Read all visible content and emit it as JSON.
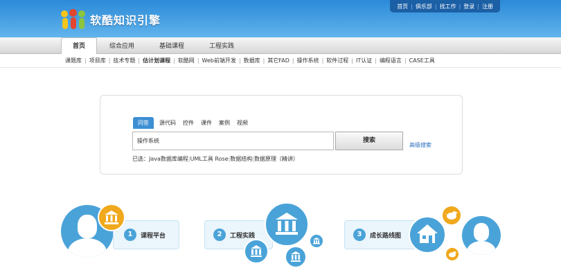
{
  "header": {
    "logo_text": "软酷知识引擎",
    "top_links": [
      "首页",
      "俱乐部",
      "找工作",
      "登录",
      "注册"
    ]
  },
  "nav": {
    "tabs": [
      "首页",
      "综合应用",
      "基础课程",
      "工程实践"
    ]
  },
  "subnav": {
    "items": [
      "课题库",
      "项目库",
      "技术专题",
      "估计划课程",
      "软酷网",
      "Web前端开发",
      "数据库",
      "其它FAD",
      "操作系统",
      "软件过程",
      "IT认证",
      "编程语言",
      "CASE工具"
    ]
  },
  "search": {
    "tabs": [
      "问答",
      "源代码",
      "控件",
      "课件",
      "案例",
      "视频"
    ],
    "input_value": "操作系统",
    "button_label": "搜索",
    "advanced_label": "高级搜索",
    "selected_prefix": "已选：",
    "selected_items": [
      "Java数据库编程",
      "UML工具 Rose",
      "数据结构",
      "数据原理（精讲）"
    ]
  },
  "features": [
    {
      "number": "1",
      "label": "课程平台"
    },
    {
      "number": "2",
      "label": "工程实践"
    },
    {
      "number": "3",
      "label": "成长路线图"
    }
  ],
  "colors": {
    "header_blue": "#2b8ad8",
    "accent_blue": "#4aa3d8",
    "badge_orange": "#f0a81c",
    "link_blue": "#2a6dbf"
  },
  "icons": [
    "bank-icon",
    "home-icon",
    "twitter-bird-icon",
    "person-silhouette-icon"
  ]
}
